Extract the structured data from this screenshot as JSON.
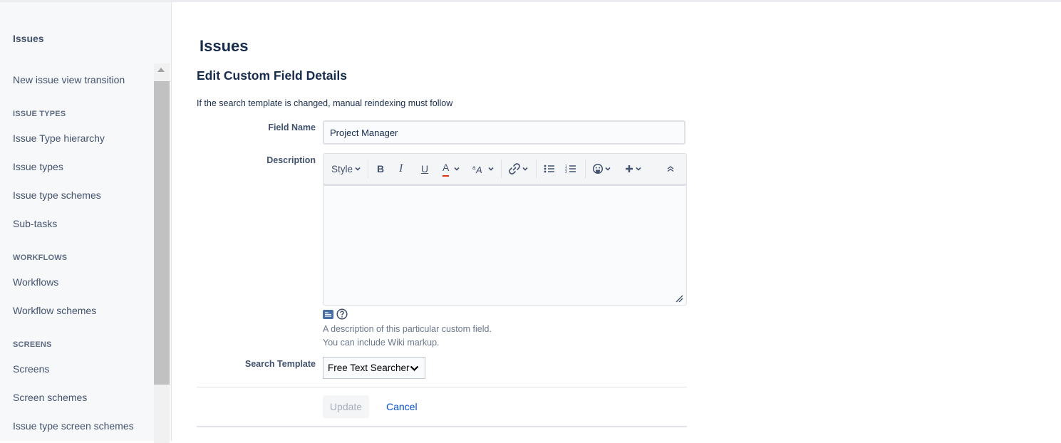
{
  "sidebar": {
    "title": "Issues",
    "items": [
      {
        "label": "New issue view transition"
      },
      {
        "section": "ISSUE TYPES"
      },
      {
        "label": "Issue Type hierarchy"
      },
      {
        "label": "Issue types"
      },
      {
        "label": "Issue type schemes"
      },
      {
        "label": "Sub-tasks"
      },
      {
        "section": "WORKFLOWS"
      },
      {
        "label": "Workflows"
      },
      {
        "label": "Workflow schemes"
      },
      {
        "section": "SCREENS"
      },
      {
        "label": "Screens"
      },
      {
        "label": "Screen schemes"
      },
      {
        "label": "Issue type screen schemes"
      }
    ]
  },
  "main": {
    "page_title": "Issues",
    "form_title": "Edit Custom Field Details",
    "note": "If the search template is changed, manual reindexing must follow",
    "field_name": {
      "label": "Field Name",
      "value": "Project Manager"
    },
    "description": {
      "label": "Description",
      "toolbar": {
        "style": "Style",
        "bold": "B",
        "italic": "I",
        "underline": "U",
        "text_color": "A",
        "text_color_bar": "#de350b",
        "icons": [
          "text-effects-icon",
          "link-icon",
          "bullet-list-icon",
          "numbered-list-icon",
          "emoji-icon",
          "insert-more-icon",
          "collapse-toolbar-icon"
        ]
      },
      "help_line1": "A description of this particular custom field.",
      "help_line2": "You can include Wiki markup."
    },
    "search_template": {
      "label": "Search Template",
      "value": "Free Text Searcher"
    },
    "buttons": {
      "update": "Update",
      "cancel": "Cancel"
    }
  },
  "colors": {
    "link": "#0052cc",
    "text": "#172b4d",
    "sidebar_bg": "#f7f8f9"
  }
}
